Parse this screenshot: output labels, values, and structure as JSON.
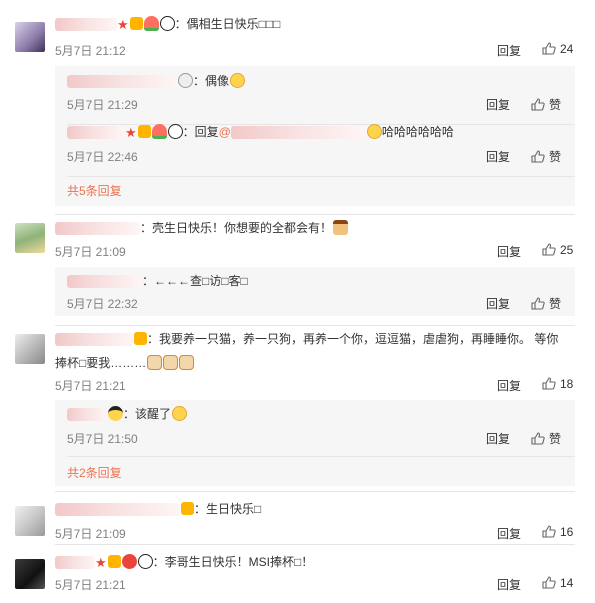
{
  "reply_label": "回复",
  "like_label": "赞",
  "comments": [
    {
      "text": "：偶相生日快乐□□□",
      "time": "5月7日 21:12",
      "likes": "24",
      "replies": [
        {
          "text": "：偶像",
          "time": "5月7日 21:29"
        },
        {
          "prefix": "：回复",
          "mention": "@",
          "text": "哈哈哈哈哈哈",
          "time": "5月7日 22:46"
        }
      ],
      "more": "共5条回复"
    },
    {
      "text": "：壳生日快乐！你想要的全都会有！",
      "time": "5月7日 21:09",
      "likes": "25",
      "replies": [
        {
          "text": "：←←←查□访□客□",
          "time": "5月7日 22:32"
        }
      ]
    },
    {
      "text": "：我要养一只猫，养一只狗，再养一个你，逗逗猫，虐虐狗，再睡睡你。 等你",
      "text2": "捧杯□要我………",
      "time": "5月7日 21:21",
      "likes": "18",
      "replies": [
        {
          "text": "：该醒了",
          "time": "5月7日 21:50"
        }
      ],
      "more": "共2条回复"
    },
    {
      "text": "：生日快乐□",
      "time": "5月7日 21:09",
      "likes": "16"
    },
    {
      "text": "：李哥生日快乐！MSI捧杯□！",
      "time": "5月7日 21:21",
      "likes": "14"
    }
  ]
}
